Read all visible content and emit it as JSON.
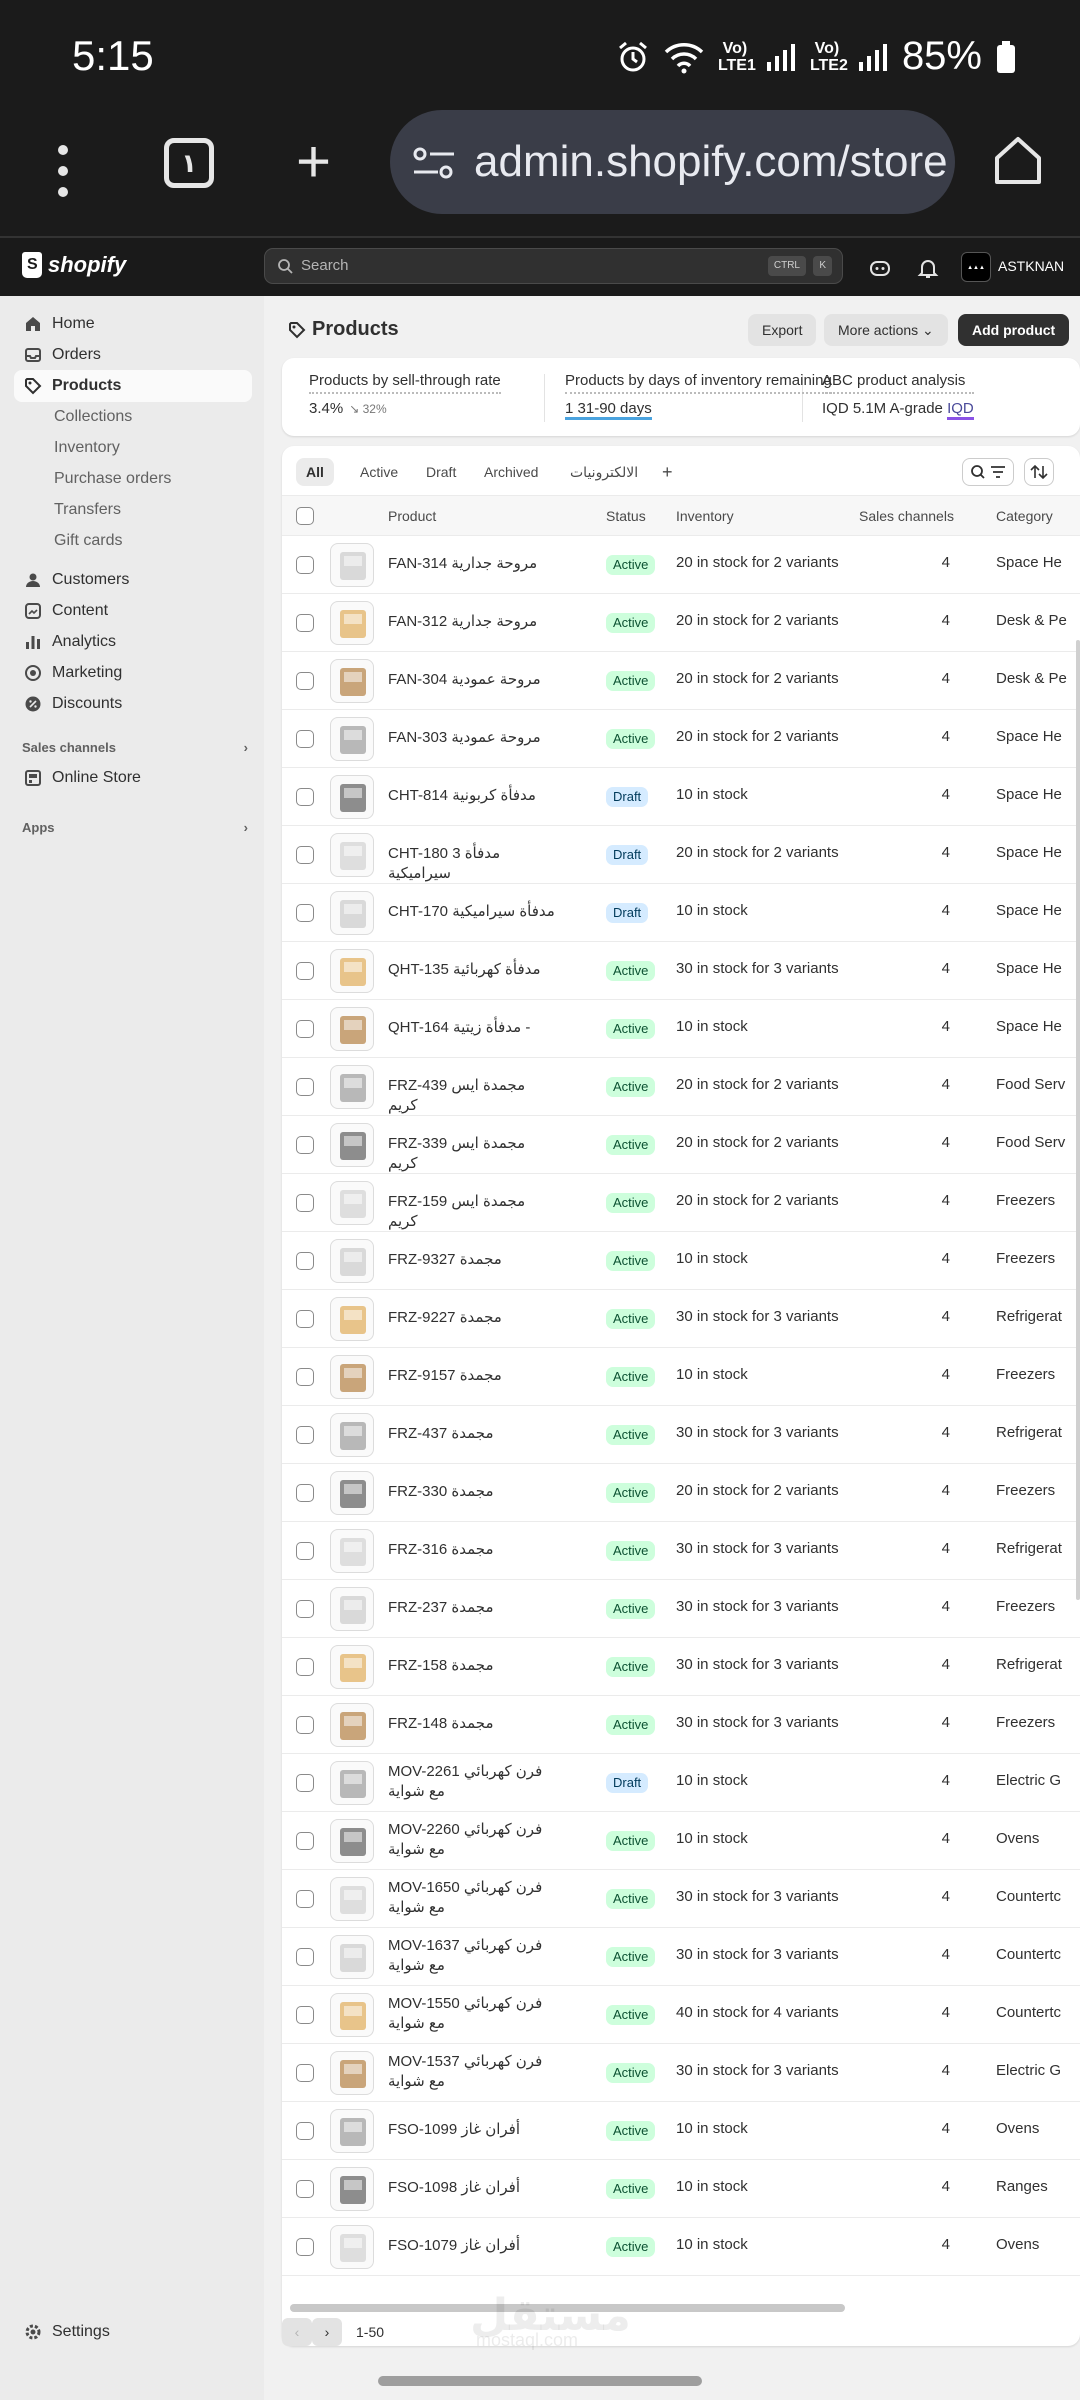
{
  "statusbar": {
    "time": "5:15",
    "battery": "85%",
    "net1": "Vo) LTE1",
    "net2": "Vo) LTE2"
  },
  "browser": {
    "url": "admin.shopify.com/store",
    "tab_count": "١"
  },
  "header": {
    "logo": "shopify",
    "search_placeholder": "Search",
    "kbd1": "CTRL",
    "kbd2": "K",
    "store_name": "ASTKNAN"
  },
  "sidebar": {
    "items": [
      {
        "label": "Home",
        "icon": "home-icon"
      },
      {
        "label": "Orders",
        "icon": "inbox-icon"
      },
      {
        "label": "Products",
        "icon": "tag-icon"
      }
    ],
    "product_sub": [
      "Collections",
      "Inventory",
      "Purchase orders",
      "Transfers",
      "Gift cards"
    ],
    "items2": [
      {
        "label": "Customers",
        "icon": "person-icon"
      },
      {
        "label": "Content",
        "icon": "content-icon"
      },
      {
        "label": "Analytics",
        "icon": "bar-chart-icon"
      },
      {
        "label": "Marketing",
        "icon": "target-icon"
      },
      {
        "label": "Discounts",
        "icon": "discount-icon"
      }
    ],
    "sales_channels": "Sales channels",
    "online_store": "Online Store",
    "apps": "Apps",
    "settings": "Settings"
  },
  "page": {
    "title": "Products",
    "export": "Export",
    "more_actions": "More actions",
    "add_product": "Add product"
  },
  "metrics": [
    {
      "label": "Products by sell-through rate",
      "value": "3.4%",
      "delta": "↘ 32%"
    },
    {
      "label": "Products by days of inventory remaining",
      "value": "1 31-90 days"
    },
    {
      "label": "ABC product analysis",
      "value": "IQD 5.1M A-grade",
      "value2": "IQD"
    }
  ],
  "tabs": [
    "All",
    "Active",
    "Draft",
    "Archived",
    "الالكترونيات"
  ],
  "columns": {
    "product": "Product",
    "status": "Status",
    "inventory": "Inventory",
    "channels": "Sales channels",
    "category": "Category"
  },
  "rows": [
    {
      "name": "FAN-314 مروحة جدارية",
      "status": "Active",
      "inventory": "20 in stock for 2 variants",
      "channels": "4",
      "category": "Space He"
    },
    {
      "name": "FAN-312 مروحة جدارية",
      "status": "Active",
      "inventory": "20 in stock for 2 variants",
      "channels": "4",
      "category": "Desk & Pe"
    },
    {
      "name": "FAN-304 مروحة عمودية",
      "status": "Active",
      "inventory": "20 in stock for 2 variants",
      "channels": "4",
      "category": "Desk & Pe"
    },
    {
      "name": "FAN-303 مروحة عمودية",
      "status": "Active",
      "inventory": "20 in stock for 2 variants",
      "channels": "4",
      "category": "Space He"
    },
    {
      "name": "CHT-814 مدفأة كربونية",
      "status": "Draft",
      "inventory": "10 in stock",
      "channels": "4",
      "category": "Space He"
    },
    {
      "name": "CHT-180 3 مدفأة سيراميكية",
      "status": "Draft",
      "inventory": "20 in stock for 2 variants",
      "channels": "4",
      "category": "Space He"
    },
    {
      "name": "CHT-170 مدفأة سيراميكية",
      "status": "Draft",
      "inventory": "10 in stock",
      "channels": "4",
      "category": "Space He"
    },
    {
      "name": "QHT-135 مدفأة كهربائية",
      "status": "Active",
      "inventory": "30 in stock for 3 variants",
      "channels": "4",
      "category": "Space He"
    },
    {
      "name": "QHT-164 مدفأة زيتية -",
      "status": "Active",
      "inventory": "10 in stock",
      "channels": "4",
      "category": "Space He"
    },
    {
      "name": "FRZ-439 مجمدة ايس كريم",
      "status": "Active",
      "inventory": "20 in stock for 2 variants",
      "channels": "4",
      "category": "Food Serv"
    },
    {
      "name": "FRZ-339 مجمدة ايس كريم",
      "status": "Active",
      "inventory": "20 in stock for 2 variants",
      "channels": "4",
      "category": "Food Serv"
    },
    {
      "name": "FRZ-159 مجمدة ايس كريم",
      "status": "Active",
      "inventory": "20 in stock for 2 variants",
      "channels": "4",
      "category": "Freezers"
    },
    {
      "name": "FRZ-9327 مجمدة",
      "status": "Active",
      "inventory": "10 in stock",
      "channels": "4",
      "category": "Freezers"
    },
    {
      "name": "FRZ-9227 مجمدة",
      "status": "Active",
      "inventory": "30 in stock for 3 variants",
      "channels": "4",
      "category": "Refrigerat"
    },
    {
      "name": "FRZ-9157 مجمدة",
      "status": "Active",
      "inventory": "10 in stock",
      "channels": "4",
      "category": "Freezers"
    },
    {
      "name": "FRZ-437 مجمدة",
      "status": "Active",
      "inventory": "30 in stock for 3 variants",
      "channels": "4",
      "category": "Refrigerat"
    },
    {
      "name": "FRZ-330 مجمدة",
      "status": "Active",
      "inventory": "20 in stock for 2 variants",
      "channels": "4",
      "category": "Freezers"
    },
    {
      "name": "FRZ-316 مجمدة",
      "status": "Active",
      "inventory": "30 in stock for 3 variants",
      "channels": "4",
      "category": "Refrigerat"
    },
    {
      "name": "FRZ-237 مجمدة",
      "status": "Active",
      "inventory": "30 in stock for 3 variants",
      "channels": "4",
      "category": "Freezers"
    },
    {
      "name": "FRZ-158 مجمدة",
      "status": "Active",
      "inventory": "30 in stock for 3 variants",
      "channels": "4",
      "category": "Refrigerat"
    },
    {
      "name": "FRZ-148 مجمدة",
      "status": "Active",
      "inventory": "30 in stock for 3 variants",
      "channels": "4",
      "category": "Freezers"
    },
    {
      "name": "MOV-2261 فرن كهربائي مع شواية",
      "status": "Draft",
      "inventory": "10 in stock",
      "channels": "4",
      "category": "Electric G"
    },
    {
      "name": "MOV-2260 فرن كهربائي مع شواية",
      "status": "Active",
      "inventory": "10 in stock",
      "channels": "4",
      "category": "Ovens"
    },
    {
      "name": "MOV-1650 فرن كهربائي مع شواية",
      "status": "Active",
      "inventory": "30 in stock for 3 variants",
      "channels": "4",
      "category": "Countertc"
    },
    {
      "name": "MOV-1637 فرن كهربائي مع شواية",
      "status": "Active",
      "inventory": "30 in stock for 3 variants",
      "channels": "4",
      "category": "Countertc"
    },
    {
      "name": "MOV-1550 فرن كهربائي مع شواية",
      "status": "Active",
      "inventory": "40 in stock for 4 variants",
      "channels": "4",
      "category": "Countertc"
    },
    {
      "name": "MOV-1537 فرن كهربائي مع شواية",
      "status": "Active",
      "inventory": "30 in stock for 3 variants",
      "channels": "4",
      "category": "Electric G"
    },
    {
      "name": "FSO-1099 أفران غاز",
      "status": "Active",
      "inventory": "10 in stock",
      "channels": "4",
      "category": "Ovens"
    },
    {
      "name": "FSO-1098 أفران غاز",
      "status": "Active",
      "inventory": "10 in stock",
      "channels": "4",
      "category": "Ranges"
    },
    {
      "name": "FSO-1079 أفران غاز",
      "status": "Active",
      "inventory": "10 in stock",
      "channels": "4",
      "category": "Ovens"
    }
  ],
  "pagination": {
    "range": "1-50"
  },
  "watermark": {
    "ar": "مستقل",
    "en": "mostaql.com"
  },
  "colors": {
    "active_badge": "#cdfedc",
    "draft_badge": "#d5ebff",
    "primary": "#303030",
    "sidebar": "#ebebeb"
  }
}
